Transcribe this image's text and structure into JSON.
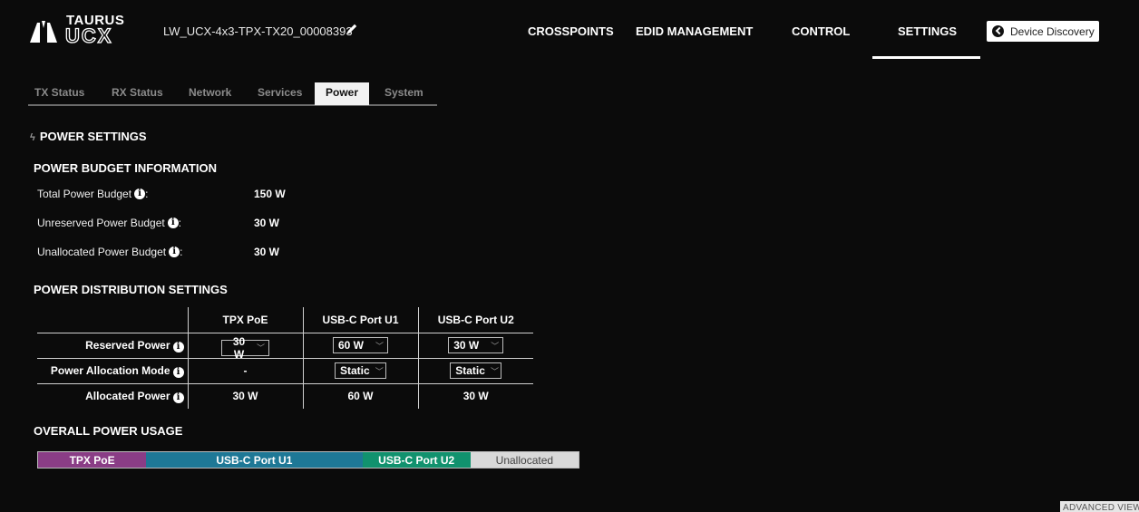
{
  "header": {
    "logo_top": "TAURUS",
    "logo_bottom": "UCX",
    "device_name": "LW_UCX-4x3-TPX-TX20_00008393",
    "nav": {
      "crosspoints": "CROSSPOINTS",
      "edid": "EDID MANAGEMENT",
      "control": "CONTROL",
      "settings": "SETTINGS"
    },
    "active_nav": "SETTINGS",
    "discovery_label": "Device Discovery"
  },
  "subtabs": {
    "tx_status": "TX Status",
    "rx_status": "RX Status",
    "network": "Network",
    "services": "Services",
    "power": "Power",
    "system": "System",
    "active": "Power"
  },
  "page": {
    "title": "POWER SETTINGS",
    "budget_title": "POWER BUDGET INFORMATION",
    "budget": {
      "total_label": "Total Power Budget",
      "total_value": "150 W",
      "unreserved_label": "Unreserved Power Budget",
      "unreserved_value": "30 W",
      "unallocated_label": "Unallocated Power Budget",
      "unallocated_value": "30 W",
      "colon": ":"
    },
    "distribution_title": "POWER DISTRIBUTION SETTINGS",
    "table": {
      "headers": [
        "TPX PoE",
        "USB-C Port U1",
        "USB-C Port U2"
      ],
      "reserved_label": "Reserved Power",
      "reserved": [
        "30 W",
        "60 W",
        "30 W"
      ],
      "mode_label": "Power Allocation Mode",
      "mode": [
        "-",
        "Static",
        "Static"
      ],
      "allocated_label": "Allocated Power",
      "allocated": [
        "30 W",
        "60 W",
        "30 W"
      ]
    },
    "usage_title": "OVERALL POWER USAGE",
    "usage": [
      {
        "label": "TPX PoE",
        "watts": 30,
        "color": "#8a3d86"
      },
      {
        "label": "USB-C Port U1",
        "watts": 60,
        "color": "#1e7896"
      },
      {
        "label": "USB-C Port U2",
        "watts": 30,
        "color": "#11926e"
      },
      {
        "label": "Unallocated",
        "watts": 30,
        "color": "#d9d9d9"
      }
    ],
    "advanced_view": "ADVANCED VIEW"
  },
  "colors": {
    "background": "#0b0b0b",
    "active_tab_bg": "#f2f2f2",
    "tpx": "#8a3d86",
    "usb_u1": "#1e7896",
    "usb_u2": "#11926e",
    "unallocated": "#d9d9d9"
  }
}
